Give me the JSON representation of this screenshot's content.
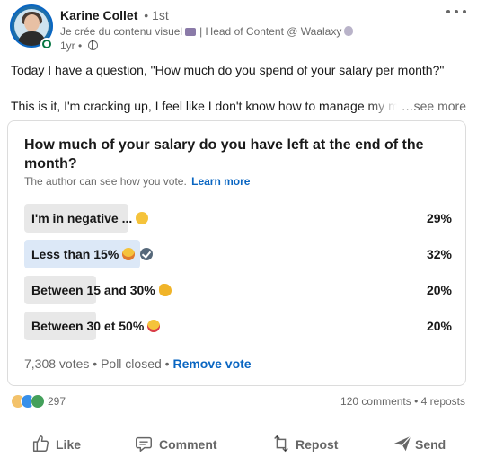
{
  "author": {
    "name": "Karine Collet",
    "degree": "• 1st",
    "headline_part1": "Je crée du contenu visuel",
    "headline_part2": "| Head of Content @ Waalaxy",
    "time": "1yr •"
  },
  "post": {
    "line1": "Today I have a question, \"How much do you spend of your salary per month?\"",
    "line2": "This is it, I'm cracking up, I feel like I don't know how to manage my m",
    "see_more": "…see more"
  },
  "poll": {
    "question": "How much of your salary do you have left at the end of the month?",
    "note": "The author can see how you vote.",
    "learn_more": "Learn more",
    "options": [
      {
        "label": "I'm in negative ...",
        "percent": "29%",
        "fraction": 0.29,
        "emoji": "face-with-rolling-eyes-icon",
        "voted": false
      },
      {
        "label": "Less than 15%",
        "percent": "32%",
        "fraction": 0.32,
        "emoji": "tears-of-joy-icon",
        "voted": true
      },
      {
        "label": "Between 15 and 30%",
        "percent": "20%",
        "fraction": 0.2,
        "emoji": "flexed-biceps-icon",
        "voted": false
      },
      {
        "label": "Between 30 et 50%",
        "percent": "20%",
        "fraction": 0.2,
        "emoji": "heart-eyes-icon",
        "voted": false
      }
    ],
    "footer": "7,308 votes • Poll closed •",
    "remove_vote": "Remove vote"
  },
  "social": {
    "reaction_count": "297",
    "comments": "120 comments",
    "separator": "•",
    "reposts": "4 reposts"
  },
  "actions": {
    "like": "Like",
    "comment": "Comment",
    "repost": "Repost",
    "send": "Send"
  },
  "colors": {
    "accent": "#0a66c2",
    "bar": "#e8e8e8",
    "bar_voted": "#dce8f7",
    "online": "#057642"
  }
}
